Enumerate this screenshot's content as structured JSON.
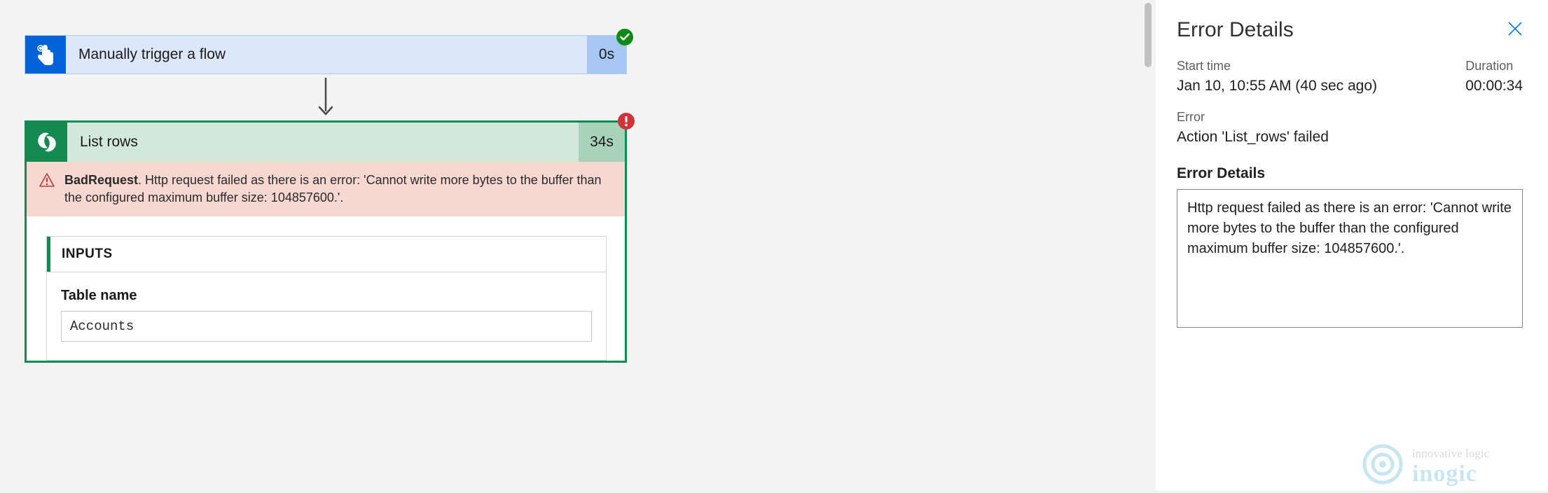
{
  "trigger": {
    "title": "Manually trigger a flow",
    "duration": "0s"
  },
  "action": {
    "title": "List rows",
    "duration": "34s",
    "error_code": "BadRequest",
    "error_message": ". Http request failed as there is an error: 'Cannot write more bytes to the buffer than the configured maximum buffer size: 104857600.'.",
    "inputs_header": "INPUTS",
    "field_label": "Table name",
    "field_value": "Accounts"
  },
  "panel": {
    "title": "Error Details",
    "start_label": "Start time",
    "start_value": "Jan 10, 10:55 AM (40 sec ago)",
    "duration_label": "Duration",
    "duration_value": "00:00:34",
    "error_label": "Error",
    "error_action": "Action 'List_rows' failed",
    "details_label": "Error Details",
    "details_text": "Http request failed as there is an error: 'Cannot write more bytes to the buffer than the configured maximum buffer size: 104857600.'."
  },
  "watermark": {
    "tagline": "innovative logic",
    "brand": "inogic"
  }
}
